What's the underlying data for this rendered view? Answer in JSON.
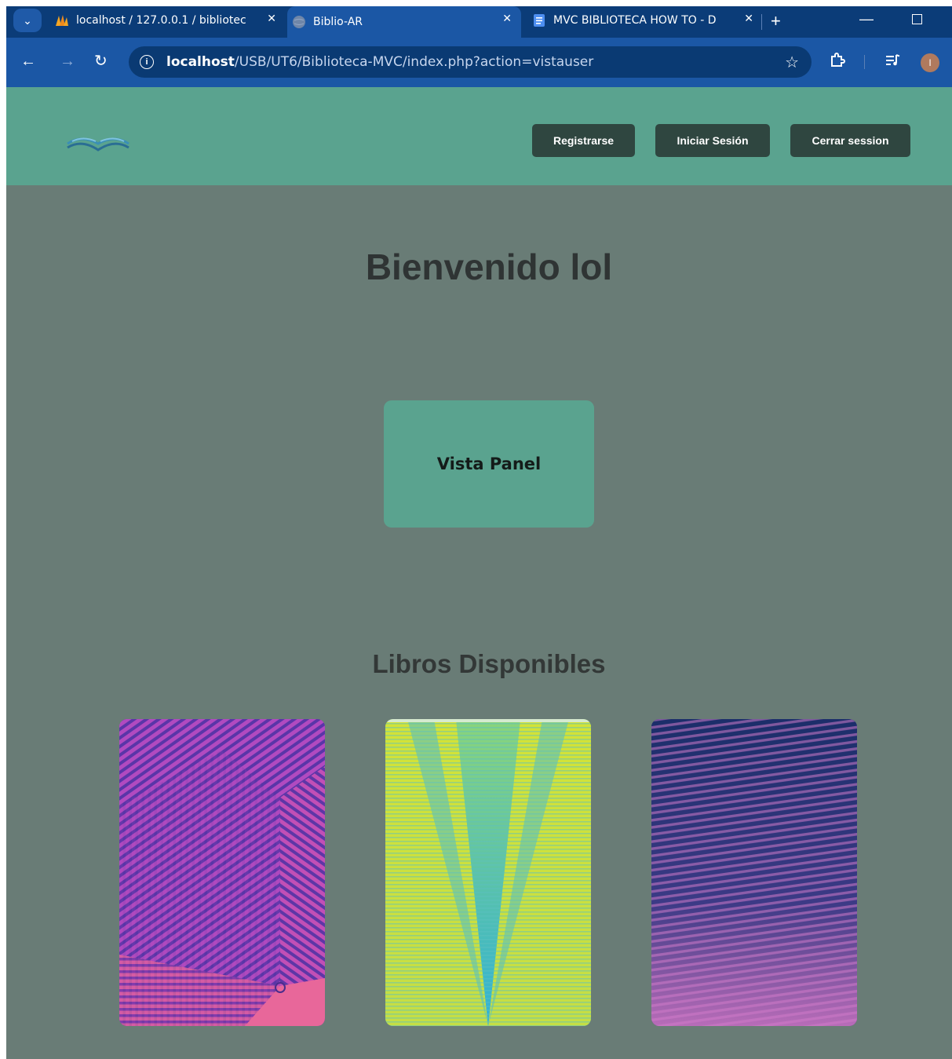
{
  "browser": {
    "tabs": [
      {
        "title": "localhost / 127.0.0.1 / bibliotec",
        "favicon": "phpmyadmin-icon",
        "active": false
      },
      {
        "title": "Biblio-AR",
        "favicon": "globe-icon",
        "active": true
      },
      {
        "title": "MVC BIBLIOTECA HOW TO - D",
        "favicon": "docs-icon",
        "active": false
      }
    ],
    "close_glyph": "✕",
    "new_tab_glyph": "+",
    "url_host": "localhost",
    "url_path": "/USB/UT6/Biblioteca-MVC/index.php?action=vistauser",
    "profile_initial": "I"
  },
  "header": {
    "register_label": "Registrarse",
    "login_label": "Iniciar Sesión",
    "logout_label": "Cerrar session"
  },
  "main": {
    "welcome": "Bienvenido lol",
    "panel_label": "Vista Panel",
    "books_title": "Libros Disponibles"
  },
  "colors": {
    "page_background": "#697c76",
    "header_background": "#5aa38f",
    "button_background": "#2f4640",
    "browser_frame": "#0b3c78",
    "browser_toolbar": "#1b57a5"
  }
}
